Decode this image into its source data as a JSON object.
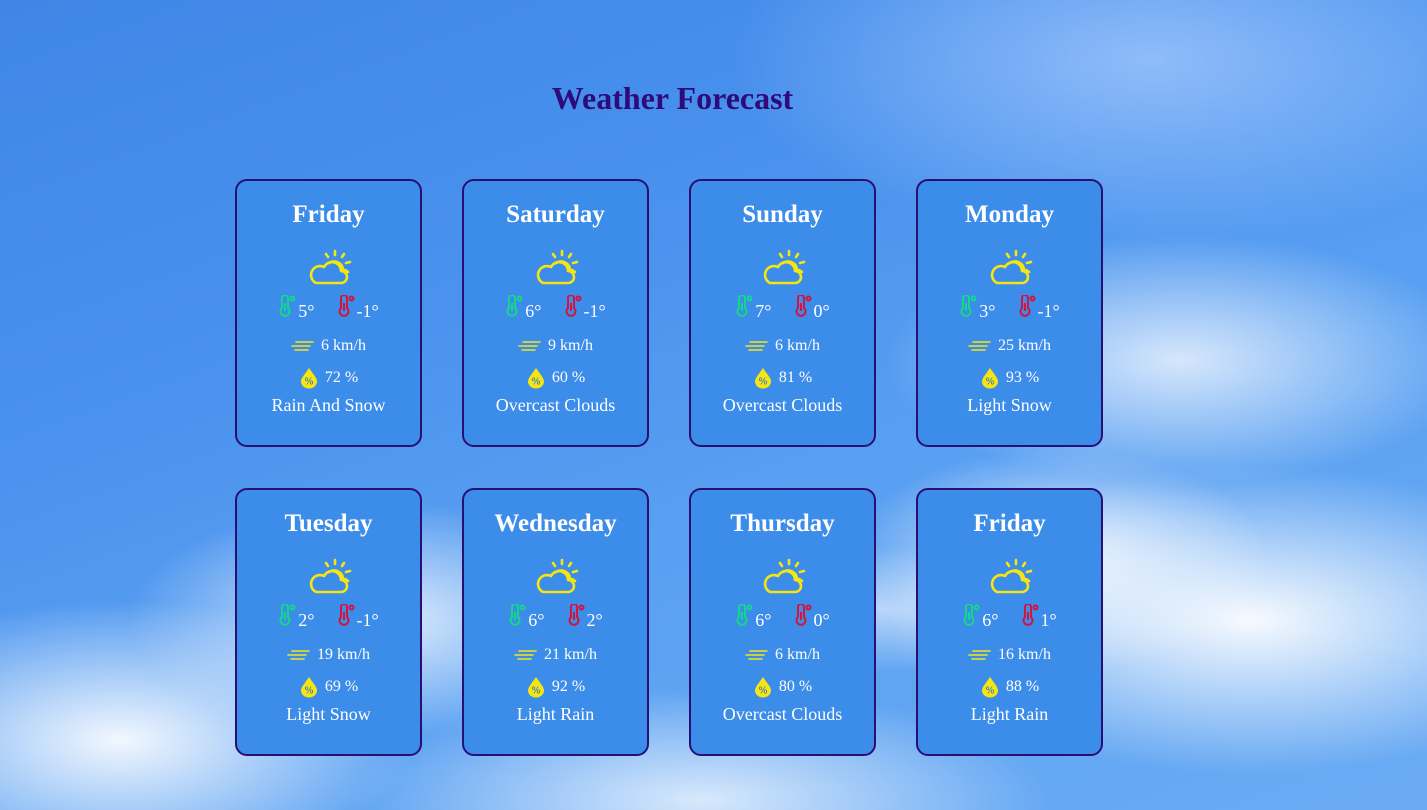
{
  "page": {
    "title": "Weather Forecast"
  },
  "colors": {
    "title": "#2e0a7a",
    "card_bg": "#3c8ce9",
    "card_border": "#2a0f73",
    "icon_yellow": "#f5e612",
    "temp_max_green": "#12d98a",
    "temp_min_red": "#d4143c"
  },
  "icons": {
    "condition": "partly-cloudy-icon",
    "max_temp": "thermometer-green-icon",
    "min_temp": "thermometer-red-icon",
    "wind": "wind-icon",
    "humidity": "humidity-drop-icon"
  },
  "forecast": [
    {
      "day": "Friday",
      "max": "5°",
      "min": "-1°",
      "wind": "6 km/h",
      "humidity": "72 %",
      "description": "Rain And Snow"
    },
    {
      "day": "Saturday",
      "max": "6°",
      "min": "-1°",
      "wind": "9 km/h",
      "humidity": "60 %",
      "description": "Overcast Clouds"
    },
    {
      "day": "Sunday",
      "max": "7°",
      "min": "0°",
      "wind": "6 km/h",
      "humidity": "81 %",
      "description": "Overcast Clouds"
    },
    {
      "day": "Monday",
      "max": "3°",
      "min": "-1°",
      "wind": "25 km/h",
      "humidity": "93 %",
      "description": "Light Snow"
    },
    {
      "day": "Tuesday",
      "max": "2°",
      "min": "-1°",
      "wind": "19 km/h",
      "humidity": "69 %",
      "description": "Light Snow"
    },
    {
      "day": "Wednesday",
      "max": "6°",
      "min": "2°",
      "wind": "21 km/h",
      "humidity": "92 %",
      "description": "Light Rain"
    },
    {
      "day": "Thursday",
      "max": "6°",
      "min": "0°",
      "wind": "6 km/h",
      "humidity": "80 %",
      "description": "Overcast Clouds"
    },
    {
      "day": "Friday",
      "max": "6°",
      "min": "1°",
      "wind": "16 km/h",
      "humidity": "88 %",
      "description": "Light Rain"
    }
  ]
}
